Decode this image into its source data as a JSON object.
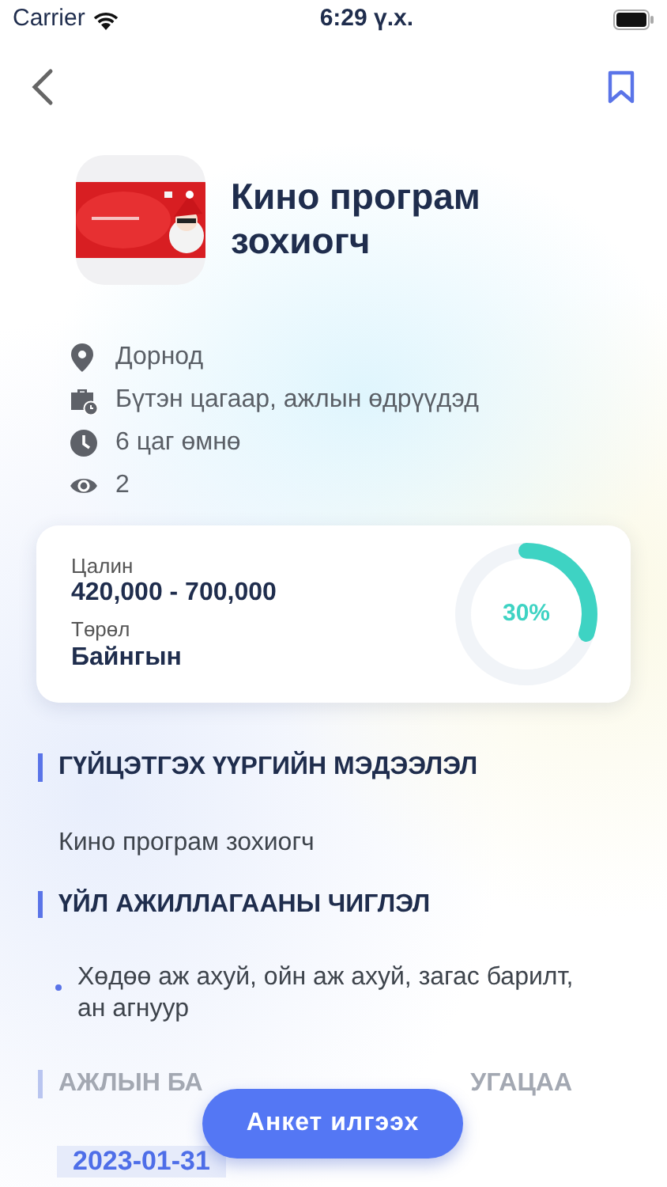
{
  "status_bar": {
    "carrier": "Carrier",
    "time": "6:29 ү.х."
  },
  "job": {
    "title": "Кино програм зохиогч",
    "bookmarked": false
  },
  "info": [
    {
      "kind": "location",
      "text": "Дорнод"
    },
    {
      "kind": "schedule",
      "text": "Бүтэн цагаар, ажлын өдрүүдэд"
    },
    {
      "kind": "time",
      "text": "6 цаг өмнө"
    },
    {
      "kind": "views",
      "text": "2"
    }
  ],
  "summary": {
    "salary_label": "Цалин",
    "salary": "420,000 - 700,000",
    "type_label": "Төрөл",
    "type": "Байнгын",
    "progress": {
      "level": 0.3,
      "reading": "30%"
    }
  },
  "sections": [
    {
      "heading": [
        "ГҮЙЦЭТГЭХ ҮҮРГИЙН МЭДЭЭЛЭЛ"
      ],
      "kind": "text",
      "text": "Кино програм зохиогч"
    },
    {
      "heading": [
        "ҮЙЛ АЖИЛЛАГААНЫ ЧИГЛЭЛ"
      ],
      "kind": "bullets",
      "items": [
        "Хөдөө аж ахуй, ойн аж ахуй, загас барилт, ан агнуур"
      ]
    },
    {
      "heading": [
        "АЖЛЫН БА",
        "УГАЦАА"
      ],
      "kind": "date",
      "text": "2023-01-31"
    }
  ],
  "apply_button": "Анкет илгээх"
}
